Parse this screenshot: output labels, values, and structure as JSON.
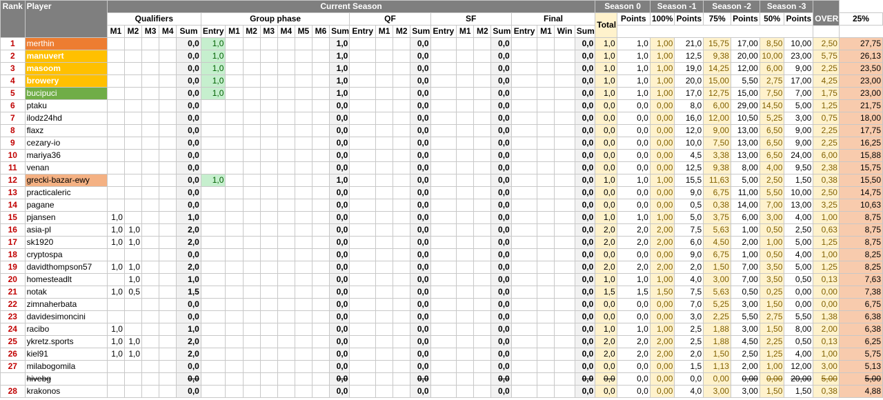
{
  "headers": {
    "rank": "Rank",
    "player": "Player",
    "current_season": "Current Season",
    "qualifiers": "Qualifiers",
    "group_phase": "Group phase",
    "qf": "QF",
    "sf": "SF",
    "final": "Final",
    "total": "Total",
    "seasons": [
      "Season 0",
      "Season -1",
      "Season -2",
      "Season -3"
    ],
    "overall": "OVERALL",
    "q_cols": [
      "M1",
      "M2",
      "M3",
      "M4",
      "Sum"
    ],
    "g_cols": [
      "Entry",
      "M1",
      "M2",
      "M3",
      "M4",
      "M5",
      "M6",
      "Sum"
    ],
    "qf_cols": [
      "Entry",
      "M1",
      "M2",
      "Sum"
    ],
    "sf_cols": [
      "Entry",
      "M1",
      "M2",
      "Sum"
    ],
    "f_cols": [
      "Entry",
      "M1",
      "Win",
      "Sum"
    ],
    "s_cols": [
      [
        "Points",
        "100%"
      ],
      [
        "Points",
        "75%"
      ],
      [
        "Points",
        "50%"
      ],
      [
        "Points",
        "25%"
      ]
    ]
  },
  "rows": [
    {
      "rank": "1",
      "player": "merthin",
      "style": "p0",
      "q": [
        "",
        "",
        "",
        ""
      ],
      "qsum": "0,0",
      "gentry": "1,0",
      "gsum": "1,0",
      "qfsum": "0,0",
      "sfsum": "0,0",
      "fsum": "0,0",
      "total": "1,0",
      "s": [
        [
          "1,0",
          "1,00"
        ],
        [
          "21,0",
          "15,75"
        ],
        [
          "17,00",
          "8,50"
        ],
        [
          "10,00",
          "2,50"
        ]
      ],
      "overall": "27,75"
    },
    {
      "rank": "2",
      "player": "manuvert",
      "style": "p1",
      "q": [
        "",
        "",
        "",
        ""
      ],
      "qsum": "0,0",
      "gentry": "1,0",
      "gsum": "1,0",
      "qfsum": "0,0",
      "sfsum": "0,0",
      "fsum": "0,0",
      "total": "1,0",
      "s": [
        [
          "1,0",
          "1,00"
        ],
        [
          "12,5",
          "9,38"
        ],
        [
          "20,00",
          "10,00"
        ],
        [
          "23,00",
          "5,75"
        ]
      ],
      "overall": "26,13"
    },
    {
      "rank": "3",
      "player": "masoom",
      "style": "p1",
      "q": [
        "",
        "",
        "",
        ""
      ],
      "qsum": "0,0",
      "gentry": "1,0",
      "gsum": "1,0",
      "qfsum": "0,0",
      "sfsum": "0,0",
      "fsum": "0,0",
      "total": "1,0",
      "s": [
        [
          "1,0",
          "1,00"
        ],
        [
          "19,0",
          "14,25"
        ],
        [
          "12,00",
          "6,00"
        ],
        [
          "9,00",
          "2,25"
        ]
      ],
      "overall": "23,50"
    },
    {
      "rank": "4",
      "player": "browery",
      "style": "p1",
      "q": [
        "",
        "",
        "",
        ""
      ],
      "qsum": "0,0",
      "gentry": "1,0",
      "gsum": "1,0",
      "qfsum": "0,0",
      "sfsum": "0,0",
      "fsum": "0,0",
      "total": "1,0",
      "s": [
        [
          "1,0",
          "1,00"
        ],
        [
          "20,0",
          "15,00"
        ],
        [
          "5,50",
          "2,75"
        ],
        [
          "17,00",
          "4,25"
        ]
      ],
      "overall": "23,00"
    },
    {
      "rank": "5",
      "player": "bucipuci",
      "style": "p2",
      "q": [
        "",
        "",
        "",
        ""
      ],
      "qsum": "0,0",
      "gentry": "1,0",
      "gsum": "1,0",
      "qfsum": "0,0",
      "sfsum": "0,0",
      "fsum": "0,0",
      "total": "1,0",
      "s": [
        [
          "1,0",
          "1,00"
        ],
        [
          "17,0",
          "12,75"
        ],
        [
          "15,00",
          "7,50"
        ],
        [
          "7,00",
          "1,75"
        ]
      ],
      "overall": "23,00"
    },
    {
      "rank": "6",
      "player": "ptaku",
      "style": "",
      "q": [
        "",
        "",
        "",
        ""
      ],
      "qsum": "0,0",
      "gentry": "",
      "gsum": "0,0",
      "qfsum": "0,0",
      "sfsum": "0,0",
      "fsum": "0,0",
      "total": "0,0",
      "s": [
        [
          "0,0",
          "0,00"
        ],
        [
          "8,0",
          "6,00"
        ],
        [
          "29,00",
          "14,50"
        ],
        [
          "5,00",
          "1,25"
        ]
      ],
      "overall": "21,75"
    },
    {
      "rank": "7",
      "player": "ilodz24hd",
      "style": "",
      "q": [
        "",
        "",
        "",
        ""
      ],
      "qsum": "0,0",
      "gentry": "",
      "gsum": "0,0",
      "qfsum": "0,0",
      "sfsum": "0,0",
      "fsum": "0,0",
      "total": "0,0",
      "s": [
        [
          "0,0",
          "0,00"
        ],
        [
          "16,0",
          "12,00"
        ],
        [
          "10,50",
          "5,25"
        ],
        [
          "3,00",
          "0,75"
        ]
      ],
      "overall": "18,00"
    },
    {
      "rank": "8",
      "player": "flaxz",
      "style": "",
      "q": [
        "",
        "",
        "",
        ""
      ],
      "qsum": "0,0",
      "gentry": "",
      "gsum": "0,0",
      "qfsum": "0,0",
      "sfsum": "0,0",
      "fsum": "0,0",
      "total": "0,0",
      "s": [
        [
          "0,0",
          "0,00"
        ],
        [
          "12,0",
          "9,00"
        ],
        [
          "13,00",
          "6,50"
        ],
        [
          "9,00",
          "2,25"
        ]
      ],
      "overall": "17,75"
    },
    {
      "rank": "9",
      "player": "cezary-io",
      "style": "",
      "q": [
        "",
        "",
        "",
        ""
      ],
      "qsum": "0,0",
      "gentry": "",
      "gsum": "0,0",
      "qfsum": "0,0",
      "sfsum": "0,0",
      "fsum": "0,0",
      "total": "0,0",
      "s": [
        [
          "0,0",
          "0,00"
        ],
        [
          "10,0",
          "7,50"
        ],
        [
          "13,00",
          "6,50"
        ],
        [
          "9,00",
          "2,25"
        ]
      ],
      "overall": "16,25"
    },
    {
      "rank": "10",
      "player": "mariya36",
      "style": "",
      "q": [
        "",
        "",
        "",
        ""
      ],
      "qsum": "0,0",
      "gentry": "",
      "gsum": "0,0",
      "qfsum": "0,0",
      "sfsum": "0,0",
      "fsum": "0,0",
      "total": "0,0",
      "s": [
        [
          "0,0",
          "0,00"
        ],
        [
          "4,5",
          "3,38"
        ],
        [
          "13,00",
          "6,50"
        ],
        [
          "24,00",
          "6,00"
        ]
      ],
      "overall": "15,88"
    },
    {
      "rank": "11",
      "player": "venan",
      "style": "",
      "q": [
        "",
        "",
        "",
        ""
      ],
      "qsum": "0,0",
      "gentry": "",
      "gsum": "0,0",
      "qfsum": "0,0",
      "sfsum": "0,0",
      "fsum": "0,0",
      "total": "0,0",
      "s": [
        [
          "0,0",
          "0,00"
        ],
        [
          "12,5",
          "9,38"
        ],
        [
          "8,00",
          "4,00"
        ],
        [
          "9,50",
          "2,38"
        ]
      ],
      "overall": "15,75"
    },
    {
      "rank": "12",
      "player": "grecki-bazar-ewy",
      "style": "p3",
      "q": [
        "",
        "",
        "",
        ""
      ],
      "qsum": "0,0",
      "gentry": "1,0",
      "gsum": "1,0",
      "qfsum": "0,0",
      "sfsum": "0,0",
      "fsum": "0,0",
      "total": "1,0",
      "s": [
        [
          "1,0",
          "1,00"
        ],
        [
          "15,5",
          "11,63"
        ],
        [
          "5,00",
          "2,50"
        ],
        [
          "1,50",
          "0,38"
        ]
      ],
      "overall": "15,50"
    },
    {
      "rank": "13",
      "player": "practicaleric",
      "style": "",
      "q": [
        "",
        "",
        "",
        ""
      ],
      "qsum": "0,0",
      "gentry": "",
      "gsum": "0,0",
      "qfsum": "0,0",
      "sfsum": "0,0",
      "fsum": "0,0",
      "total": "0,0",
      "s": [
        [
          "0,0",
          "0,00"
        ],
        [
          "9,0",
          "6,75"
        ],
        [
          "11,00",
          "5,50"
        ],
        [
          "10,00",
          "2,50"
        ]
      ],
      "overall": "14,75"
    },
    {
      "rank": "14",
      "player": "pagane",
      "style": "",
      "q": [
        "",
        "",
        "",
        ""
      ],
      "qsum": "0,0",
      "gentry": "",
      "gsum": "0,0",
      "qfsum": "0,0",
      "sfsum": "0,0",
      "fsum": "0,0",
      "total": "0,0",
      "s": [
        [
          "0,0",
          "0,00"
        ],
        [
          "0,5",
          "0,38"
        ],
        [
          "14,00",
          "7,00"
        ],
        [
          "13,00",
          "3,25"
        ]
      ],
      "overall": "10,63"
    },
    {
      "rank": "15",
      "player": "pjansen",
      "style": "",
      "q": [
        "1,0",
        "",
        "",
        ""
      ],
      "qsum": "1,0",
      "gentry": "",
      "gsum": "0,0",
      "qfsum": "0,0",
      "sfsum": "0,0",
      "fsum": "0,0",
      "total": "1,0",
      "s": [
        [
          "1,0",
          "1,00"
        ],
        [
          "5,0",
          "3,75"
        ],
        [
          "6,00",
          "3,00"
        ],
        [
          "4,00",
          "1,00"
        ]
      ],
      "overall": "8,75"
    },
    {
      "rank": "16",
      "player": "asia-pl",
      "style": "",
      "q": [
        "1,0",
        "1,0",
        "",
        ""
      ],
      "qsum": "2,0",
      "gentry": "",
      "gsum": "0,0",
      "qfsum": "0,0",
      "sfsum": "0,0",
      "fsum": "0,0",
      "total": "2,0",
      "s": [
        [
          "2,0",
          "2,00"
        ],
        [
          "7,5",
          "5,63"
        ],
        [
          "1,00",
          "0,50"
        ],
        [
          "2,50",
          "0,63"
        ]
      ],
      "overall": "8,75"
    },
    {
      "rank": "17",
      "player": "sk1920",
      "style": "",
      "q": [
        "1,0",
        "1,0",
        "",
        ""
      ],
      "qsum": "2,0",
      "gentry": "",
      "gsum": "0,0",
      "qfsum": "0,0",
      "sfsum": "0,0",
      "fsum": "0,0",
      "total": "2,0",
      "s": [
        [
          "2,0",
          "2,00"
        ],
        [
          "6,0",
          "4,50"
        ],
        [
          "2,00",
          "1,00"
        ],
        [
          "5,00",
          "1,25"
        ]
      ],
      "overall": "8,75"
    },
    {
      "rank": "18",
      "player": "cryptospa",
      "style": "",
      "q": [
        "",
        "",
        "",
        ""
      ],
      "qsum": "0,0",
      "gentry": "",
      "gsum": "0,0",
      "qfsum": "0,0",
      "sfsum": "0,0",
      "fsum": "0,0",
      "total": "0,0",
      "s": [
        [
          "0,0",
          "0,00"
        ],
        [
          "9,0",
          "6,75"
        ],
        [
          "1,00",
          "0,50"
        ],
        [
          "4,00",
          "1,00"
        ]
      ],
      "overall": "8,25"
    },
    {
      "rank": "19",
      "player": "davidthompson57",
      "style": "",
      "q": [
        "1,0",
        "1,0",
        "",
        ""
      ],
      "qsum": "2,0",
      "gentry": "",
      "gsum": "0,0",
      "qfsum": "0,0",
      "sfsum": "0,0",
      "fsum": "0,0",
      "total": "2,0",
      "s": [
        [
          "2,0",
          "2,00"
        ],
        [
          "2,0",
          "1,50"
        ],
        [
          "7,00",
          "3,50"
        ],
        [
          "5,00",
          "1,25"
        ]
      ],
      "overall": "8,25"
    },
    {
      "rank": "20",
      "player": "homesteadlt",
      "style": "",
      "q": [
        "",
        "1,0",
        "",
        ""
      ],
      "qsum": "1,0",
      "gentry": "",
      "gsum": "0,0",
      "qfsum": "0,0",
      "sfsum": "0,0",
      "fsum": "0,0",
      "total": "1,0",
      "s": [
        [
          "1,0",
          "1,00"
        ],
        [
          "4,0",
          "3,00"
        ],
        [
          "7,00",
          "3,50"
        ],
        [
          "0,50",
          "0,13"
        ]
      ],
      "overall": "7,63"
    },
    {
      "rank": "21",
      "player": "notak",
      "style": "",
      "q": [
        "1,0",
        "0,5",
        "",
        ""
      ],
      "qsum": "1,5",
      "gentry": "",
      "gsum": "0,0",
      "qfsum": "0,0",
      "sfsum": "0,0",
      "fsum": "0,0",
      "total": "1,5",
      "s": [
        [
          "1,5",
          "1,50"
        ],
        [
          "7,5",
          "5,63"
        ],
        [
          "0,50",
          "0,25"
        ],
        [
          "0,00",
          "0,00"
        ]
      ],
      "overall": "7,38"
    },
    {
      "rank": "22",
      "player": "zimnaherbata",
      "style": "",
      "q": [
        "",
        "",
        "",
        ""
      ],
      "qsum": "0,0",
      "gentry": "",
      "gsum": "0,0",
      "qfsum": "0,0",
      "sfsum": "0,0",
      "fsum": "0,0",
      "total": "0,0",
      "s": [
        [
          "0,0",
          "0,00"
        ],
        [
          "7,0",
          "5,25"
        ],
        [
          "3,00",
          "1,50"
        ],
        [
          "0,00",
          "0,00"
        ]
      ],
      "overall": "6,75"
    },
    {
      "rank": "23",
      "player": "davidesimoncini",
      "style": "",
      "q": [
        "",
        "",
        "",
        ""
      ],
      "qsum": "0,0",
      "gentry": "",
      "gsum": "0,0",
      "qfsum": "0,0",
      "sfsum": "0,0",
      "fsum": "0,0",
      "total": "0,0",
      "s": [
        [
          "0,0",
          "0,00"
        ],
        [
          "3,0",
          "2,25"
        ],
        [
          "5,50",
          "2,75"
        ],
        [
          "5,50",
          "1,38"
        ]
      ],
      "overall": "6,38"
    },
    {
      "rank": "24",
      "player": "racibo",
      "style": "",
      "q": [
        "1,0",
        "",
        "",
        ""
      ],
      "qsum": "1,0",
      "gentry": "",
      "gsum": "0,0",
      "qfsum": "0,0",
      "sfsum": "0,0",
      "fsum": "0,0",
      "total": "1,0",
      "s": [
        [
          "1,0",
          "1,00"
        ],
        [
          "2,5",
          "1,88"
        ],
        [
          "3,00",
          "1,50"
        ],
        [
          "8,00",
          "2,00"
        ]
      ],
      "overall": "6,38"
    },
    {
      "rank": "25",
      "player": "ykretz.sports",
      "style": "",
      "q": [
        "1,0",
        "1,0",
        "",
        ""
      ],
      "qsum": "2,0",
      "gentry": "",
      "gsum": "0,0",
      "qfsum": "0,0",
      "sfsum": "0,0",
      "fsum": "0,0",
      "total": "2,0",
      "s": [
        [
          "2,0",
          "2,00"
        ],
        [
          "2,5",
          "1,88"
        ],
        [
          "4,50",
          "2,25"
        ],
        [
          "0,50",
          "0,13"
        ]
      ],
      "overall": "6,25"
    },
    {
      "rank": "26",
      "player": "kiel91",
      "style": "",
      "q": [
        "1,0",
        "1,0",
        "",
        ""
      ],
      "qsum": "2,0",
      "gentry": "",
      "gsum": "0,0",
      "qfsum": "0,0",
      "sfsum": "0,0",
      "fsum": "0,0",
      "total": "2,0",
      "s": [
        [
          "2,0",
          "2,00"
        ],
        [
          "2,0",
          "1,50"
        ],
        [
          "2,50",
          "1,25"
        ],
        [
          "4,00",
          "1,00"
        ]
      ],
      "overall": "5,75"
    },
    {
      "rank": "27",
      "player": "milabogomila",
      "style": "",
      "q": [
        "",
        "",
        "",
        ""
      ],
      "qsum": "0,0",
      "gentry": "",
      "gsum": "0,0",
      "qfsum": "0,0",
      "sfsum": "0,0",
      "fsum": "0,0",
      "total": "0,0",
      "s": [
        [
          "0,0",
          "0,00"
        ],
        [
          "1,5",
          "1,13"
        ],
        [
          "2,00",
          "1,00"
        ],
        [
          "12,00",
          "3,00"
        ]
      ],
      "overall": "5,13"
    },
    {
      "rank": "",
      "player": "hivebg",
      "style": "strike",
      "q": [
        "",
        "",
        "",
        ""
      ],
      "qsum": "0,0",
      "gentry": "",
      "gsum": "0,0",
      "qfsum": "0,0",
      "sfsum": "0,0",
      "fsum": "0,0",
      "total": "0,0",
      "s": [
        [
          "0,0",
          "0,00"
        ],
        [
          "0,0",
          "0,00"
        ],
        [
          "0,00",
          "0,00"
        ],
        [
          "20,00",
          "5,00"
        ]
      ],
      "overall": "5,00"
    },
    {
      "rank": "28",
      "player": "krakonos",
      "style": "",
      "q": [
        "",
        "",
        "",
        ""
      ],
      "qsum": "0,0",
      "gentry": "",
      "gsum": "0,0",
      "qfsum": "0,0",
      "sfsum": "0,0",
      "fsum": "0,0",
      "total": "0,0",
      "s": [
        [
          "0,0",
          "0,00"
        ],
        [
          "4,0",
          "3,00"
        ],
        [
          "3,00",
          "1,50"
        ],
        [
          "1,50",
          "0,38"
        ]
      ],
      "overall": "4,88"
    }
  ]
}
